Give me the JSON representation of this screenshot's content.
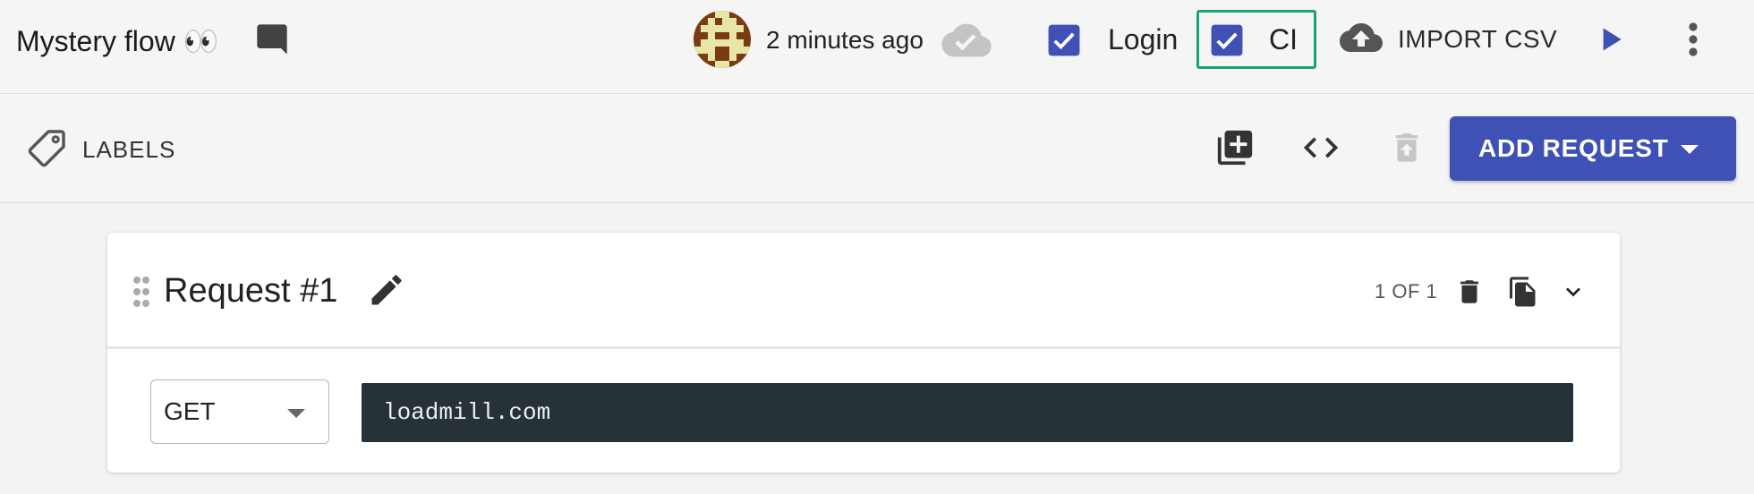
{
  "header": {
    "flow_title": "Mystery flow 👀",
    "saved_time": "2 minutes ago",
    "login_label": "Login",
    "login_checked": true,
    "ci_label": "CI",
    "ci_checked": true,
    "import_label": "IMPORT CSV",
    "accent_color": "#3f51b5",
    "ci_highlight_color": "#1aa37a"
  },
  "toolbar": {
    "labels_label": "LABELS",
    "add_request_label": "ADD REQUEST"
  },
  "request": {
    "title": "Request #1",
    "count": "1 OF 1",
    "method": "GET",
    "url": "loadmill.com"
  },
  "icons": {
    "comment": "comment-icon",
    "cloud_saved": "cloud-done-icon",
    "import": "cloud-upload-icon",
    "run": "play-icon",
    "more": "more-vert-icon",
    "label": "label-outline-icon",
    "add_box": "library-add-icon",
    "code": "code-icon",
    "delete_disabled": "delete-restore-icon",
    "edit": "pencil-icon",
    "delete": "trash-icon",
    "duplicate": "copy-file-icon",
    "collapse": "chevron-down-icon",
    "drag": "drag-handle-icon"
  }
}
